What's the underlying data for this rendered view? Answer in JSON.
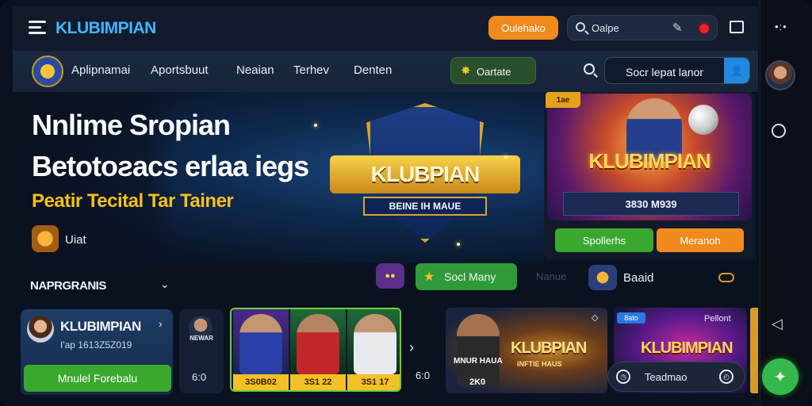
{
  "topbar": {
    "brand": "KLUBIMPIAN",
    "orange_button": "Oulehako",
    "search_text": "Oalpe",
    "colors": {
      "brand": "#3fb6ff",
      "orange": "#f08a1d"
    }
  },
  "nav": {
    "items": [
      "Aplipnamai",
      "Aportsbuut",
      "Neaian",
      "Terhev",
      "Denten"
    ],
    "green_pill": "Oartate",
    "search_label": "Socr lepat lanor"
  },
  "hero": {
    "line1": "Nnlime Sropian",
    "line2": "Betotoƨacs erlaa iegs",
    "line3": "Peatir Tecital Tar Tainer",
    "coin_label": "Uiat",
    "shield_title": "KLUBPIAN",
    "shield_sub": "BEINE IH MAUE"
  },
  "promo": {
    "tag": "1ae",
    "title": "KLUBIMPIAN",
    "bar_text": "3830 M939",
    "btn_green": "Spollerhs",
    "btn_orange": "Meranoh"
  },
  "section": {
    "title": "NAPRGRANIS",
    "chips": {
      "green": "Socl Many",
      "dim": "Nanue",
      "image_label": "Baaid"
    }
  },
  "cards": {
    "profile": {
      "name": "KLUBIMPIAN",
      "sub": "I'ap 1613Z5Z019",
      "button": "Mnulel Forebalu"
    },
    "mini": {
      "label": "NEWAR",
      "count": "6:0"
    },
    "players": [
      {
        "caption": "3S0B02",
        "shirt": "#2a3fa8"
      },
      {
        "caption": "3S1 22",
        "shirt": "#c2262a"
      },
      {
        "caption": "3S1 17",
        "shirt": "#e8eaee"
      }
    ],
    "count_right": "6:0",
    "banner": {
      "title": "KLUBPIAN",
      "sub": "MNUR HAUA",
      "banner_text": "INFTIE HAUS",
      "price": "2K0"
    },
    "magenta": {
      "tag": "8ato",
      "top_label": "Pellont",
      "title": "KLUBIMPIAN"
    },
    "toast": "Teadmao"
  },
  "rail": {
    "dots": "•:•"
  }
}
